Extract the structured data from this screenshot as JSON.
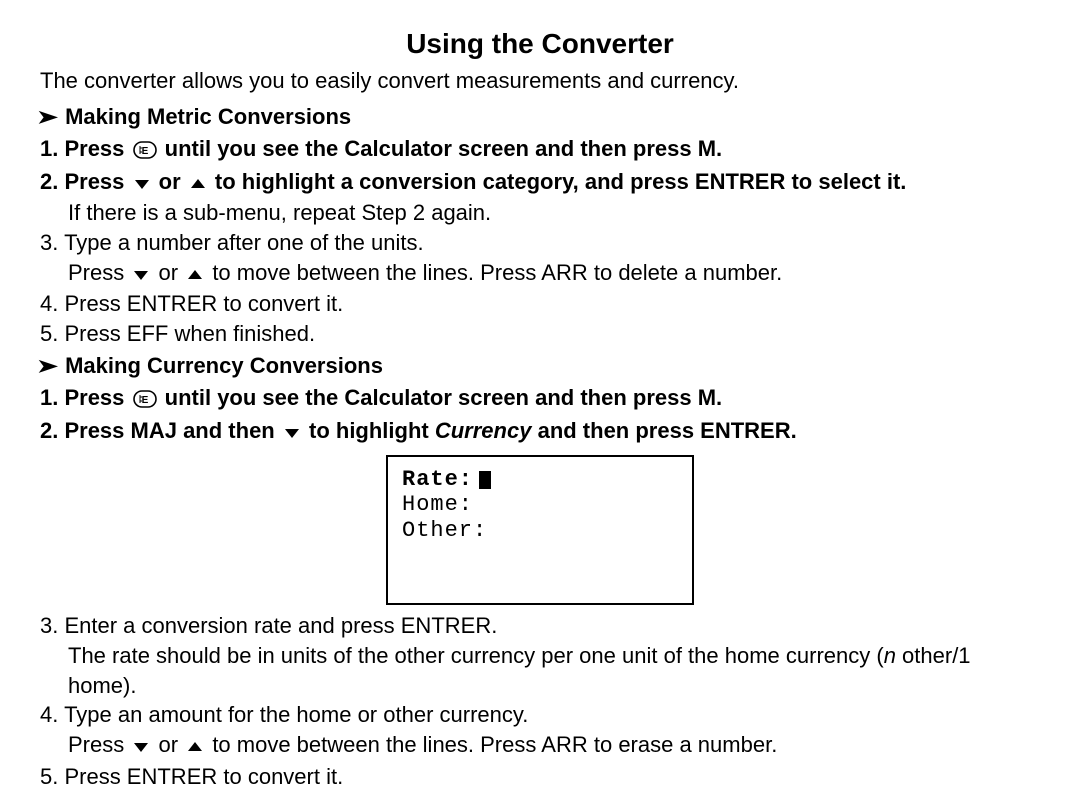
{
  "title": "Using the Converter",
  "intro": "The converter allows you to easily convert measurements and currency.",
  "metric": {
    "heading": "Making Metric Conversions",
    "step1_a": "1. Press",
    "step1_b": "until you see the Calculator screen and then press M.",
    "step2_a": "2. Press",
    "step2_b": "or",
    "step2_c": "to highlight a conversion category, and press ENTRER to select it.",
    "step2_sub": "If there is a sub-menu, repeat Step 2 again.",
    "step3": "3. Type a number after one of the units.",
    "step3_sub_a": "Press",
    "step3_sub_b": "or",
    "step3_sub_c": "to move between the lines. Press",
    "step3_sub_d": "ARR",
    "step3_sub_e": "to delete a number.",
    "step4": "4. Press ENTRER to convert it.",
    "step5": "5. Press EFF when finished."
  },
  "currency": {
    "heading": "Making Currency Conversions",
    "step1_a": "1. Press",
    "step1_b": "until you see the Calculator screen and then press M.",
    "step2_a": "2. Press MAJ and then",
    "step2_b": "to highlight",
    "step2_c": "Currency",
    "step2_d": "and then press ENTRER.",
    "screen": {
      "rate_label": "Rate:",
      "home_label": "Home:",
      "other_label": "Other:"
    },
    "step3": "3. Enter a conversion rate and press ENTRER.",
    "step3_sub_a": "The rate should be in units of the other currency per one unit of the home currency (",
    "step3_sub_b": "n",
    "step3_sub_c": " other/1 home).",
    "step4": "4. Type an amount for the home or other currency.",
    "step4_sub_a": "Press",
    "step4_sub_b": "or",
    "step4_sub_c": "to move between the lines. Press",
    "step4_sub_d": "ARR",
    "step4_sub_e": "to erase a number.",
    "step5": "5. Press ENTRER to convert it."
  }
}
